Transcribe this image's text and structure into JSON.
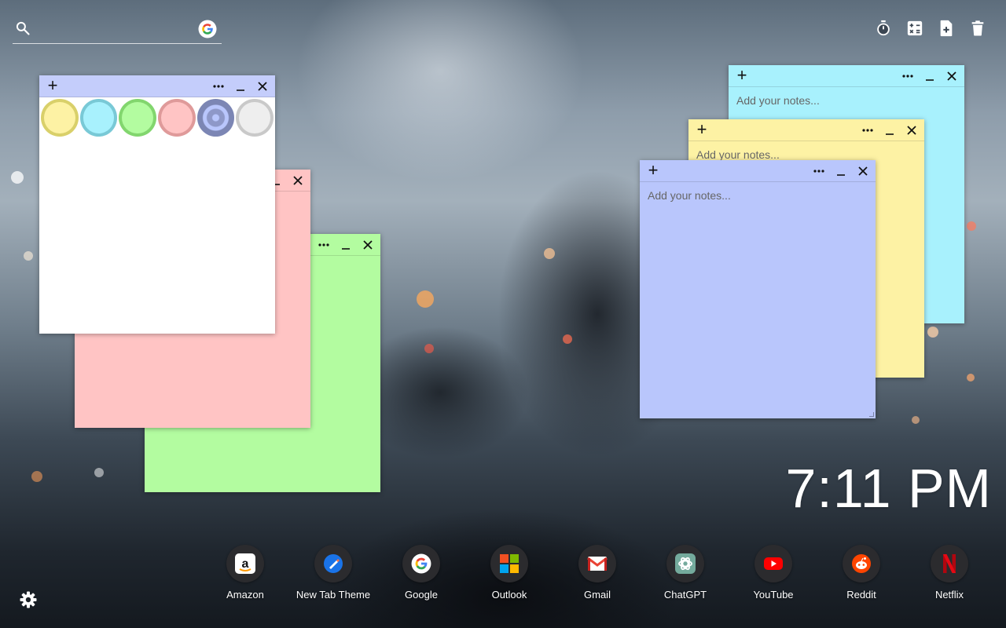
{
  "search": {
    "value": "",
    "placeholder": "",
    "search_icon": "magnifier-icon",
    "engine_icon": "google-logo-icon"
  },
  "toolbar": {
    "icons": [
      "stopwatch-icon",
      "calculator-icon",
      "new-note-icon",
      "trash-icon"
    ]
  },
  "notes": [
    {
      "id": "white",
      "color": "#ffffff",
      "bar_color": "#c4cdfb",
      "placeholder": ""
    },
    {
      "id": "pink",
      "color": "#ffc4c4",
      "placeholder": ""
    },
    {
      "id": "green",
      "color": "#b3fca0",
      "placeholder": ""
    },
    {
      "id": "cyan",
      "color": "#a8f1fd",
      "placeholder": "Add your notes..."
    },
    {
      "id": "yellow",
      "color": "#fdf2a4",
      "placeholder": "Add your notes..."
    },
    {
      "id": "blue",
      "color": "#b9c6fc",
      "placeholder": "Add your notes..."
    }
  ],
  "palette": [
    {
      "name": "yellow",
      "fill": "#fdf2a4",
      "ring": "#d9d06a"
    },
    {
      "name": "cyan",
      "fill": "#a8f1fd",
      "ring": "#79c9d6"
    },
    {
      "name": "green",
      "fill": "#b3fca0",
      "ring": "#82d66e"
    },
    {
      "name": "pink",
      "fill": "#ffc4c4",
      "ring": "#df9a9a"
    },
    {
      "name": "blue",
      "fill": "#b9c6fc",
      "ring": "#7c86b4",
      "selected": true
    },
    {
      "name": "white",
      "fill": "#eeeeee",
      "ring": "#c9c9c9"
    }
  ],
  "clock": {
    "time": "7:11 PM"
  },
  "shortcuts": [
    {
      "label": "Amazon",
      "icon": "amazon-icon"
    },
    {
      "label": "New Tab Theme",
      "icon": "new-tab-theme-icon"
    },
    {
      "label": "Google",
      "icon": "google-icon"
    },
    {
      "label": "Outlook",
      "icon": "outlook-icon"
    },
    {
      "label": "Gmail",
      "icon": "gmail-icon"
    },
    {
      "label": "ChatGPT",
      "icon": "chatgpt-icon"
    },
    {
      "label": "YouTube",
      "icon": "youtube-icon"
    },
    {
      "label": "Reddit",
      "icon": "reddit-icon"
    },
    {
      "label": "Netflix",
      "icon": "netflix-icon"
    }
  ],
  "settings": {
    "icon": "gear-icon"
  }
}
